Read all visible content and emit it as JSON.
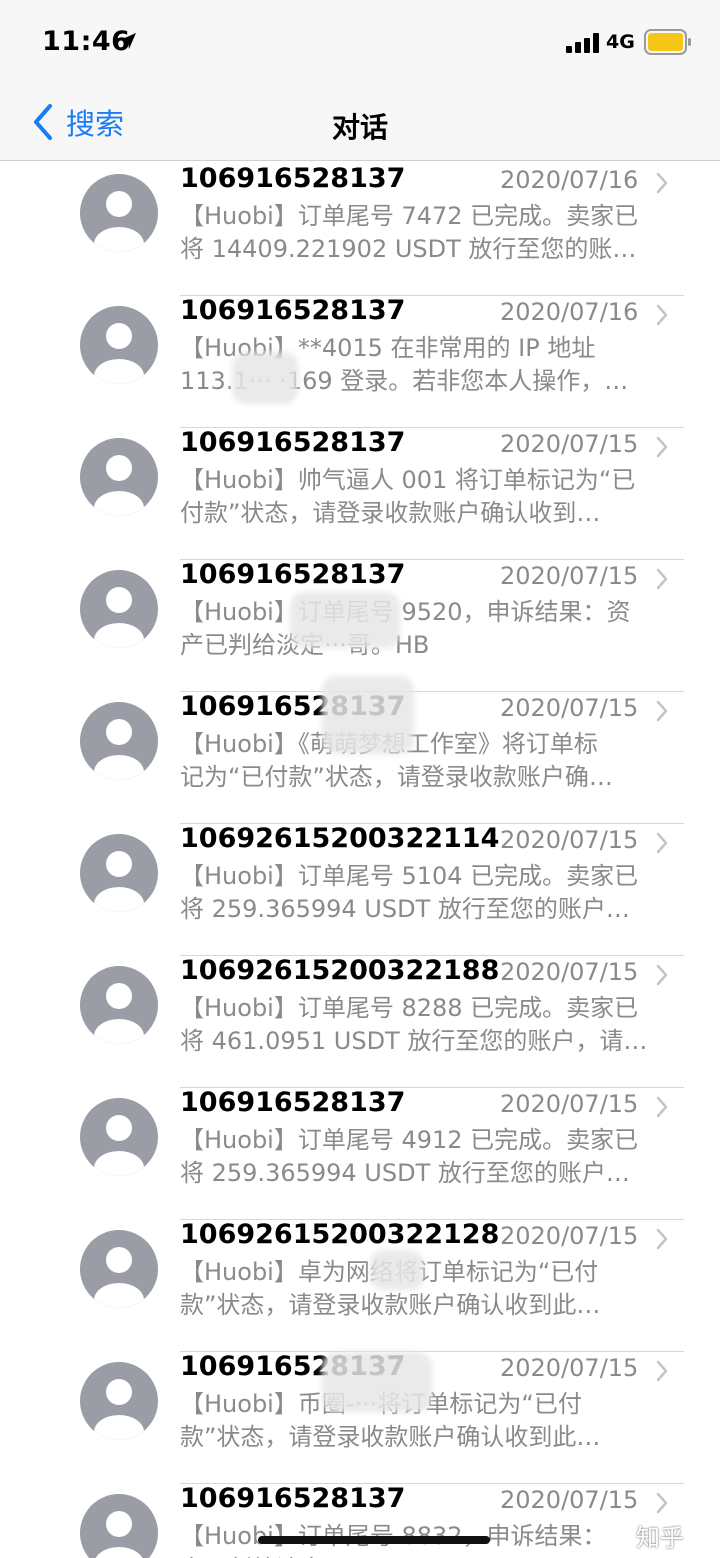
{
  "status": {
    "time": "11:46",
    "network": "4G",
    "icons": [
      "location-arrow-icon",
      "cellular-signal-icon",
      "battery-icon"
    ],
    "battery_color": "#f5c518"
  },
  "nav": {
    "back_label": "搜索",
    "title": "对话",
    "accent_color": "#1a7cf5"
  },
  "conversations": [
    {
      "sender": "106916528137",
      "date": "2020/07/16",
      "line1": "【Huobi】订单尾号 7472 已完成。卖家已",
      "line2": "将 14409.221902 USDT 放行至您的账…"
    },
    {
      "sender": "106916528137",
      "date": "2020/07/16",
      "line1": "【Huobi】**4015 在非常用的 IP 地址",
      "line2": "113.1··· ·169 登录。若非您本人操作，…"
    },
    {
      "sender": "106916528137",
      "date": "2020/07/15",
      "line1": "【Huobi】帅气逼人 001 将订单标记为“已",
      "line2": "付款”状态，请登录收款账户确认收到…"
    },
    {
      "sender": "106916528137",
      "date": "2020/07/15",
      "line1": "【Huobi】订单尾号 9520，申诉结果：资",
      "line2": "产已判给淡定···哥。HB"
    },
    {
      "sender": "106916528137",
      "date": "2020/07/15",
      "line1": "【Huobi】《萌萌梦想工作室》将订单标",
      "line2": "记为“已付款”状态，请登录收款账户确…"
    },
    {
      "sender": "10692615200322114",
      "date": "2020/07/15",
      "line1": "【Huobi】订单尾号 5104 已完成。卖家已",
      "line2": "将 259.365994 USDT 放行至您的账户…"
    },
    {
      "sender": "10692615200322188",
      "date": "2020/07/15",
      "line1": "【Huobi】订单尾号 8288 已完成。卖家已",
      "line2": "将 461.0951 USDT 放行至您的账户，请…"
    },
    {
      "sender": "106916528137",
      "date": "2020/07/15",
      "line1": "【Huobi】订单尾号 4912 已完成。卖家已",
      "line2": "将 259.365994 USDT 放行至您的账户…"
    },
    {
      "sender": "10692615200322128",
      "date": "2020/07/15",
      "line1": "【Huobi】卓为网络将订单标记为“已付",
      "line2": "款”状态，请登录收款账户确认收到此…"
    },
    {
      "sender": "106916528137",
      "date": "2020/07/15",
      "line1": "【Huobi】币圈-···将订单标记为“已付",
      "line2": "款”状态，请登录收款账户确认收到此…"
    },
    {
      "sender": "106916528137",
      "date": "2020/07/15",
      "line1": "【Huobi】订单尾号 8832，申诉结果：",
      "line2": "产已判给淡定···哥。"
    }
  ],
  "watermark": "知乎"
}
